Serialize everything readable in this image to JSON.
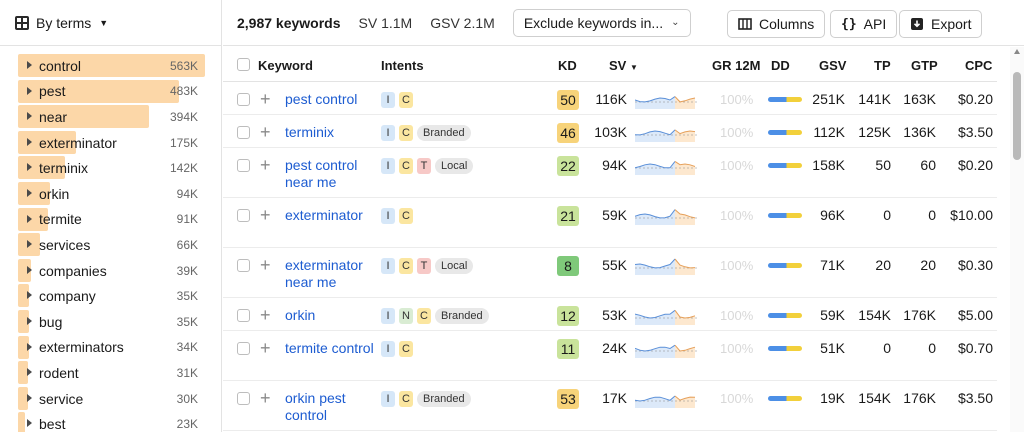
{
  "sidebar": {
    "title": "By terms",
    "items": [
      {
        "label": "control",
        "count": "563K",
        "fraction": 1.0
      },
      {
        "label": "pest",
        "count": "483K",
        "fraction": 0.86
      },
      {
        "label": "near",
        "count": "394K",
        "fraction": 0.7
      },
      {
        "label": "exterminator",
        "count": "175K",
        "fraction": 0.31
      },
      {
        "label": "terminix",
        "count": "142K",
        "fraction": 0.25
      },
      {
        "label": "orkin",
        "count": "94K",
        "fraction": 0.17
      },
      {
        "label": "termite",
        "count": "91K",
        "fraction": 0.16
      },
      {
        "label": "services",
        "count": "66K",
        "fraction": 0.12
      },
      {
        "label": "companies",
        "count": "39K",
        "fraction": 0.07
      },
      {
        "label": "company",
        "count": "35K",
        "fraction": 0.06
      },
      {
        "label": "bug",
        "count": "35K",
        "fraction": 0.06
      },
      {
        "label": "exterminators",
        "count": "34K",
        "fraction": 0.06
      },
      {
        "label": "rodent",
        "count": "31K",
        "fraction": 0.055
      },
      {
        "label": "service",
        "count": "30K",
        "fraction": 0.053
      },
      {
        "label": "best",
        "count": "23K",
        "fraction": 0.04
      }
    ]
  },
  "header": {
    "keyword_count": "2,987 keywords",
    "sv": "SV 1.1M",
    "gsv": "GSV 2.1M",
    "filter_label": "Exclude keywords in...",
    "columns_label": "Columns",
    "api_label": "API",
    "export_label": "Export"
  },
  "table": {
    "columns": {
      "keyword": "Keyword",
      "intents": "Intents",
      "kd": "KD",
      "sv": "SV",
      "gr": "GR 12M",
      "dd": "DD",
      "gsv": "GSV",
      "tp": "TP",
      "gtp": "GTP",
      "cpc": "CPC"
    },
    "rows": [
      {
        "keyword": "pest control",
        "intents": [
          "I",
          "C"
        ],
        "tag": "",
        "kd": "50",
        "sv": "116K",
        "gr": "100%",
        "gsv": "251K",
        "tp": "141K",
        "gtp": "163K",
        "cpc": "$0.20",
        "h": 33
      },
      {
        "keyword": "terminix",
        "intents": [
          "I",
          "C"
        ],
        "tag": "Branded",
        "kd": "46",
        "sv": "103K",
        "gr": "100%",
        "gsv": "112K",
        "tp": "125K",
        "gtp": "136K",
        "cpc": "$3.50",
        "h": 33
      },
      {
        "keyword": "pest control near me",
        "intents": [
          "I",
          "C",
          "T"
        ],
        "tag": "Local",
        "kd": "22",
        "sv": "94K",
        "gr": "100%",
        "gsv": "158K",
        "tp": "50",
        "gtp": "60",
        "cpc": "$0.20",
        "h": 50
      },
      {
        "keyword": "exterminator",
        "intents": [
          "I",
          "C"
        ],
        "tag": "",
        "kd": "21",
        "sv": "59K",
        "gr": "100%",
        "gsv": "96K",
        "tp": "0",
        "gtp": "0",
        "cpc": "$10.00",
        "h": 50
      },
      {
        "keyword": "exterminator near me",
        "intents": [
          "I",
          "C",
          "T"
        ],
        "tag": "Local",
        "kd": "8",
        "sv": "55K",
        "gr": "100%",
        "gsv": "71K",
        "tp": "20",
        "gtp": "20",
        "cpc": "$0.30",
        "h": 50
      },
      {
        "keyword": "orkin",
        "intents": [
          "I",
          "N",
          "C"
        ],
        "tag": "Branded",
        "kd": "12",
        "sv": "53K",
        "gr": "100%",
        "gsv": "59K",
        "tp": "154K",
        "gtp": "176K",
        "cpc": "$5.00",
        "h": 33
      },
      {
        "keyword": "termite control",
        "intents": [
          "I",
          "C"
        ],
        "tag": "",
        "kd": "11",
        "sv": "24K",
        "gr": "100%",
        "gsv": "51K",
        "tp": "0",
        "gtp": "0",
        "cpc": "$0.70",
        "h": 50
      },
      {
        "keyword": "orkin pest control",
        "intents": [
          "I",
          "C"
        ],
        "tag": "Branded",
        "kd": "53",
        "sv": "17K",
        "gr": "100%",
        "gsv": "19K",
        "tp": "154K",
        "gtp": "176K",
        "cpc": "$3.50",
        "h": 50
      }
    ]
  },
  "colors": {
    "bar": "#fcd7a8",
    "link": "#1d5cd1",
    "kd_easy": "#9ed38f",
    "kd_mid": "#c9e39b",
    "kd_hard": "#f7d37a"
  }
}
